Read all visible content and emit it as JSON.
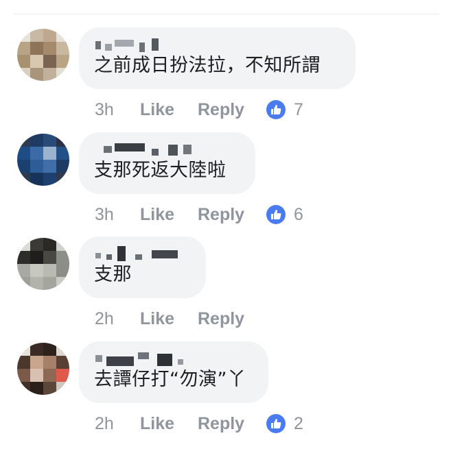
{
  "comments": [
    {
      "text": "之前成日扮法拉，不知所謂",
      "time": "3h",
      "like": "Like",
      "reply": "Reply",
      "likes": "7"
    },
    {
      "text": "支那死返大陸啦",
      "time": "3h",
      "like": "Like",
      "reply": "Reply",
      "likes": "6"
    },
    {
      "text": "支那",
      "time": "2h",
      "like": "Like",
      "reply": "Reply",
      "likes": ""
    },
    {
      "text": "去譚仔打“勿演”丫",
      "time": "2h",
      "like": "Like",
      "reply": "Reply",
      "likes": "2"
    }
  ],
  "colors": {
    "bubble": "#f2f3f5",
    "meta": "#90949c",
    "like_badge": "#4a7cf0"
  },
  "icons": {
    "reaction": "thumbs-up-icon",
    "avatar": "avatar-icon"
  }
}
